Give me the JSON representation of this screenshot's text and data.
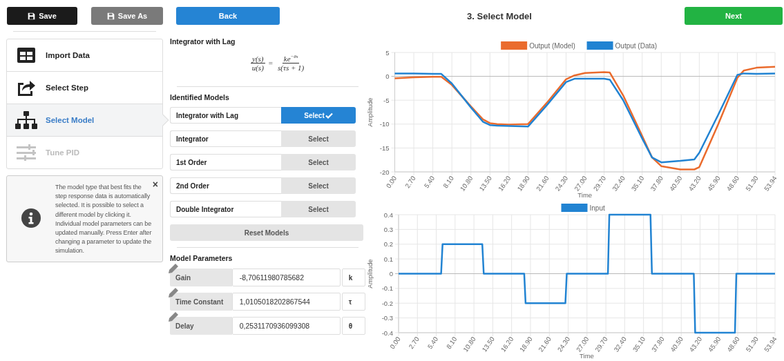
{
  "toolbar": {
    "save": "Save",
    "save_as": "Save As",
    "back": "Back",
    "title": "3. Select Model",
    "next": "Next"
  },
  "steps": [
    {
      "label": "Import Data",
      "selected": false,
      "disabled": false
    },
    {
      "label": "Select Step",
      "selected": false,
      "disabled": false
    },
    {
      "label": "Select Model",
      "selected": true,
      "disabled": false
    },
    {
      "label": "Tune PID",
      "selected": false,
      "disabled": true
    }
  ],
  "info": {
    "text": "The model type that best fits the step response data is automatically selected. It is possible to select a different model by clicking it. Individual model parameters can be updated manually. Press Enter after changing a parameter to update the simulation.",
    "close": "×"
  },
  "model": {
    "title": "Integrator with Lag",
    "formula": {
      "left_numerator": "y(s)",
      "left_denominator": "u(s)",
      "equals": "=",
      "right_numerator": "ke$^{−θs}$",
      "right_denominator": "s(τs + 1)"
    }
  },
  "identified_models": {
    "title": "Identified Models",
    "items": [
      {
        "name": "Integrator with Lag",
        "select_label": "Select",
        "selected": true
      },
      {
        "name": "Integrator",
        "select_label": "Select",
        "selected": false
      },
      {
        "name": "1st Order",
        "select_label": "Select",
        "selected": false
      },
      {
        "name": "2nd Order",
        "select_label": "Select",
        "selected": false
      },
      {
        "name": "Double Integrator",
        "select_label": "Select",
        "selected": false
      }
    ],
    "reset": "Reset Models"
  },
  "parameters": {
    "title": "Model Parameters",
    "items": [
      {
        "label": "Gain",
        "value": "-8,70611980785682",
        "unit": "k"
      },
      {
        "label": "Time Constant",
        "value": "1,0105018202867544",
        "unit": "τ"
      },
      {
        "label": "Delay",
        "value": "0,2531170936099308",
        "unit": "θ"
      }
    ]
  },
  "charts": [
    {
      "chart_data": {
        "type": "line",
        "grid": true,
        "legend": true,
        "xlabel": "Time",
        "ylabel": "Amplitude",
        "x": [
          0,
          2.7,
          5.4,
          6.6,
          8.1,
          10.8,
          12.5,
          13.5,
          14.5,
          16.2,
          18.9,
          21.6,
          24.3,
          25.5,
          27,
          29.7,
          30.5,
          32.4,
          35.1,
          36.5,
          37.8,
          40.5,
          42.5,
          43.2,
          45.9,
          48.6,
          49.5,
          51.3,
          53.94
        ],
        "series": [
          {
            "name": "Output (Model)",
            "color": "#ea6b2d",
            "values": [
              -0.4,
              -0.2,
              -0.1,
              -0.1,
              -1.8,
              -6.3,
              -9,
              -9.8,
              -10,
              -10.1,
              -10,
              -5.5,
              -0.6,
              0.2,
              0.7,
              0.9,
              0.8,
              -4,
              -12.5,
              -17,
              -18.8,
              -19.5,
              -19.5,
              -19,
              -10,
              -0.3,
              1.2,
              1.8,
              2.0
            ]
          },
          {
            "name": "Output (Data)",
            "color": "#2183d2",
            "values": [
              0.6,
              0.6,
              0.5,
              0.5,
              -1.5,
              -6.5,
              -9.5,
              -10.2,
              -10.3,
              -10.4,
              -10.5,
              -6,
              -1.2,
              -0.5,
              -0.5,
              -0.5,
              -0.7,
              -5,
              -13,
              -17,
              -18,
              -17.7,
              -17.4,
              -16,
              -8,
              0.3,
              0.6,
              0.5,
              0.6
            ]
          }
        ],
        "xlim": [
          0,
          53.94
        ],
        "ylim": [
          -20,
          5
        ],
        "yticks": [
          5,
          0,
          -5,
          -10,
          -15,
          -20
        ],
        "xticks": [
          {
            "value": 0,
            "label": "0.00"
          },
          {
            "value": 2.7,
            "label": "2.70"
          },
          {
            "value": 5.4,
            "label": "5.40"
          },
          {
            "value": 8.1,
            "label": "8.10"
          },
          {
            "value": 10.8,
            "label": "10.80"
          },
          {
            "value": 13.5,
            "label": "13.50"
          },
          {
            "value": 16.2,
            "label": "16.20"
          },
          {
            "value": 18.9,
            "label": "18.90"
          },
          {
            "value": 21.6,
            "label": "21.60"
          },
          {
            "value": 24.3,
            "label": "24.30"
          },
          {
            "value": 27,
            "label": "27.00"
          },
          {
            "value": 29.7,
            "label": "29.70"
          },
          {
            "value": 32.4,
            "label": "32.40"
          },
          {
            "value": 35.1,
            "label": "35.10"
          },
          {
            "value": 37.8,
            "label": "37.80"
          },
          {
            "value": 40.5,
            "label": "40.50"
          },
          {
            "value": 43.2,
            "label": "43.20"
          },
          {
            "value": 45.9,
            "label": "45.90"
          },
          {
            "value": 48.6,
            "label": "48.60"
          },
          {
            "value": 51.3,
            "label": "51.30"
          },
          {
            "value": 53.94,
            "label": "53.94"
          }
        ]
      }
    },
    {
      "chart_data": {
        "type": "line",
        "grid": true,
        "legend": true,
        "xlabel": "Time",
        "ylabel": "Amplitude",
        "x": [
          0,
          6.1,
          6.3,
          12.0,
          12.2,
          18.0,
          18.2,
          23.9,
          24.1,
          30.0,
          30.2,
          36.1,
          36.3,
          42.3,
          42.5,
          48.2,
          48.4,
          53.94
        ],
        "series": [
          {
            "name": "Input",
            "color": "#2183d2",
            "values": [
              0,
              0,
              0.2,
              0.2,
              0,
              0,
              -0.2,
              -0.2,
              0,
              0,
              0.4,
              0.4,
              0,
              0,
              -0.4,
              -0.4,
              0,
              0
            ]
          }
        ],
        "xlim": [
          0,
          53.94
        ],
        "ylim": [
          -0.4,
          0.4
        ],
        "yticks": [
          0.4,
          0.3,
          0.2,
          0.1,
          0,
          -0.1,
          -0.2,
          -0.3,
          -0.4
        ],
        "xticks": [
          {
            "value": 0,
            "label": "0.00"
          },
          {
            "value": 2.7,
            "label": "2.70"
          },
          {
            "value": 5.4,
            "label": "5.40"
          },
          {
            "value": 8.1,
            "label": "8.10"
          },
          {
            "value": 10.8,
            "label": "10.80"
          },
          {
            "value": 13.5,
            "label": "13.50"
          },
          {
            "value": 16.2,
            "label": "16.20"
          },
          {
            "value": 18.9,
            "label": "18.90"
          },
          {
            "value": 21.6,
            "label": "21.60"
          },
          {
            "value": 24.3,
            "label": "24.30"
          },
          {
            "value": 27,
            "label": "27.00"
          },
          {
            "value": 29.7,
            "label": "29.70"
          },
          {
            "value": 32.4,
            "label": "32.40"
          },
          {
            "value": 35.1,
            "label": "35.10"
          },
          {
            "value": 37.8,
            "label": "37.80"
          },
          {
            "value": 40.5,
            "label": "40.50"
          },
          {
            "value": 43.2,
            "label": "43.20"
          },
          {
            "value": 45.9,
            "label": "45.90"
          },
          {
            "value": 48.6,
            "label": "48.60"
          },
          {
            "value": 51.3,
            "label": "51.30"
          },
          {
            "value": 53.94,
            "label": "53.94"
          }
        ]
      }
    }
  ]
}
